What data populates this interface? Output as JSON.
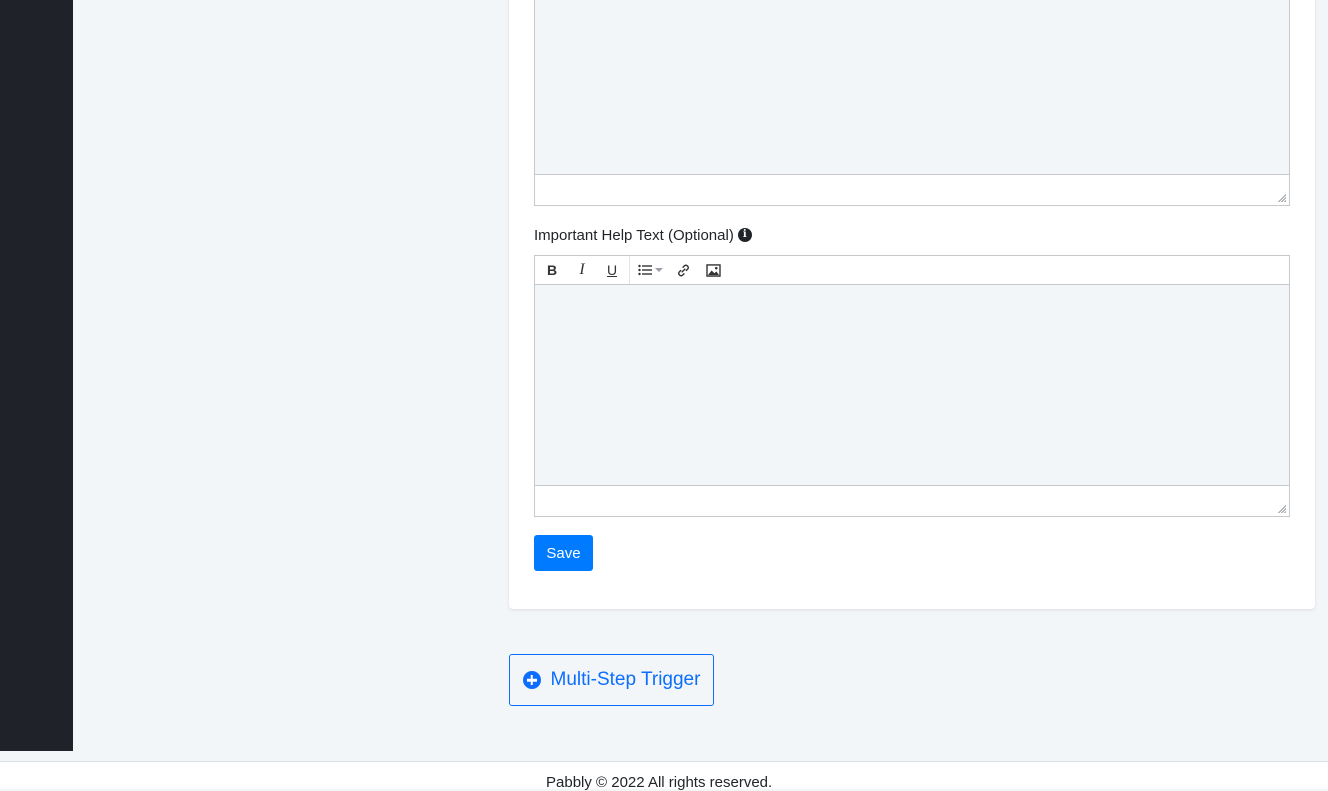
{
  "help_text_field": {
    "label": "Important Help Text (Optional)",
    "info_icon": "info-circle-icon"
  },
  "toolbar": {
    "bold": "B",
    "italic": "I",
    "underline": "U",
    "list_icon": "bullet-list-icon",
    "link_icon": "link-icon",
    "image_icon": "image-icon"
  },
  "actions": {
    "save_label": "Save",
    "multi_step_trigger_label": "Multi-Step Trigger"
  },
  "footer": {
    "copyright": "Pabbly © 2022 All rights reserved."
  },
  "colors": {
    "primary": "#007bff",
    "sidebar": "#1f2329",
    "background": "#f3f6f9"
  }
}
